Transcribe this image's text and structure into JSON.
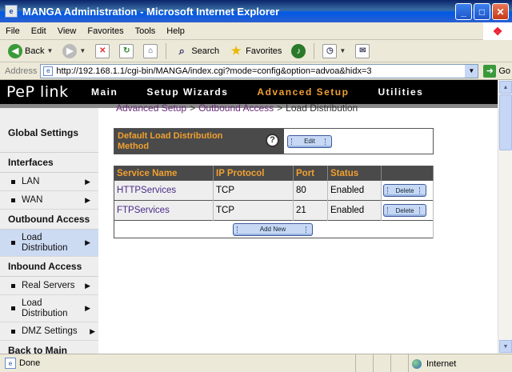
{
  "window": {
    "title": "MANGA Administration - Microsoft Internet Explorer",
    "minimize": "_",
    "maximize": "□",
    "close": "✕"
  },
  "menu": [
    "File",
    "Edit",
    "View",
    "Favorites",
    "Tools",
    "Help"
  ],
  "toolbar": {
    "back_label": "Back",
    "search_label": "Search",
    "favorites_label": "Favorites"
  },
  "address": {
    "label": "Address",
    "url": "http://192.168.1.1/cgi-bin/MANGA/index.cgi?mode=config&option=advoa&hidx=3",
    "go_label": "Go"
  },
  "app": {
    "logo": "PeP link",
    "nav": [
      {
        "label": "Main",
        "active": false
      },
      {
        "label": "Setup Wizards",
        "active": false
      },
      {
        "label": "Advanced Setup",
        "active": true
      },
      {
        "label": "Utilities",
        "active": false
      }
    ],
    "active_color": "#f0a030"
  },
  "sidebar": {
    "global_settings": "Global Settings",
    "interfaces": "Interfaces",
    "lan": "LAN",
    "wan": "WAN",
    "outbound_access": "Outbound Access",
    "load_distribution_active": "Load Distribution",
    "inbound_access": "Inbound Access",
    "real_servers": "Real Servers",
    "load_distribution": "Load Distribution",
    "dmz_settings": "DMZ Settings",
    "back_to_main": "Back to Main"
  },
  "breadcrumb": {
    "part1": "Advanced Setup",
    "part2": "Outbound Access",
    "part3": "Load Distribution",
    "sep": ">"
  },
  "lb_method": {
    "label": "Default Load Distribution Method",
    "help": "?",
    "edit_label": "Edit"
  },
  "services": {
    "headers": [
      "Service Name",
      "IP Protocol",
      "Port",
      "Status"
    ],
    "rows": [
      {
        "name": "HTTPServices",
        "protocol": "TCP",
        "port": "80",
        "status": "Enabled",
        "action": "Delete"
      },
      {
        "name": "FTPServices",
        "protocol": "TCP",
        "port": "21",
        "status": "Enabled",
        "action": "Delete"
      }
    ],
    "add_label": "Add New"
  },
  "status": {
    "text": "Done",
    "zone": "Internet"
  }
}
